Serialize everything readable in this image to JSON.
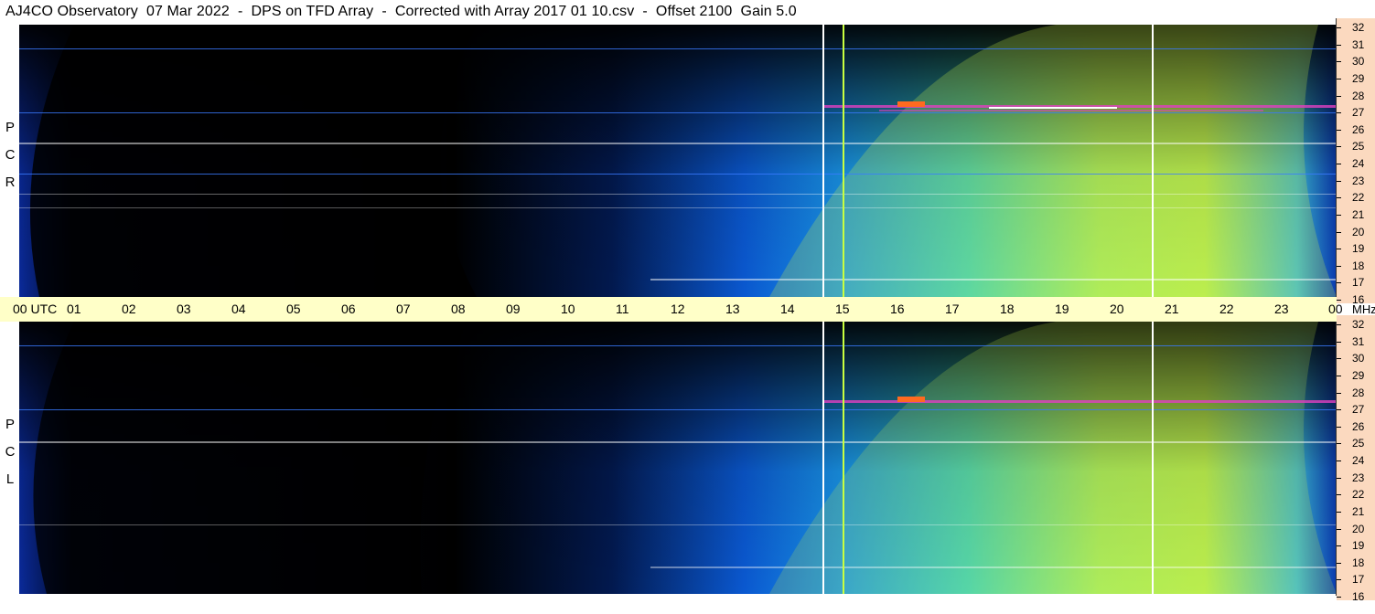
{
  "header": {
    "title": "AJ4CO Observatory  07 Mar 2022  -  DPS on TFD Array  -  Corrected with Array 2017 01 10.csv  -  Offset 2100  Gain 5.0"
  },
  "panels": {
    "top": {
      "polarization_letters": [
        "P",
        "C",
        "R"
      ]
    },
    "bottom": {
      "polarization_letters": [
        "P",
        "C",
        "L"
      ]
    }
  },
  "freq_axis": {
    "unit": "MHz",
    "ticks": [
      "32",
      "31",
      "30",
      "29",
      "28",
      "27",
      "26",
      "25",
      "24",
      "23",
      "22",
      "21",
      "20",
      "19",
      "18",
      "17",
      "16"
    ]
  },
  "time_axis": {
    "start_label": "00  UTC",
    "hours": [
      "01",
      "02",
      "03",
      "04",
      "05",
      "06",
      "07",
      "08",
      "09",
      "10",
      "11",
      "12",
      "13",
      "14",
      "15",
      "16",
      "17",
      "18",
      "19",
      "20",
      "21",
      "22",
      "23"
    ],
    "end_label": "00"
  },
  "colors": {
    "background": "#000510",
    "time_axis_bg": "#ffffc8",
    "freq_axis_bg": "#fbd9bf",
    "low_intensity": "#003cd0",
    "high_intensity": "#d8f050",
    "interference": "#e040c0"
  }
}
